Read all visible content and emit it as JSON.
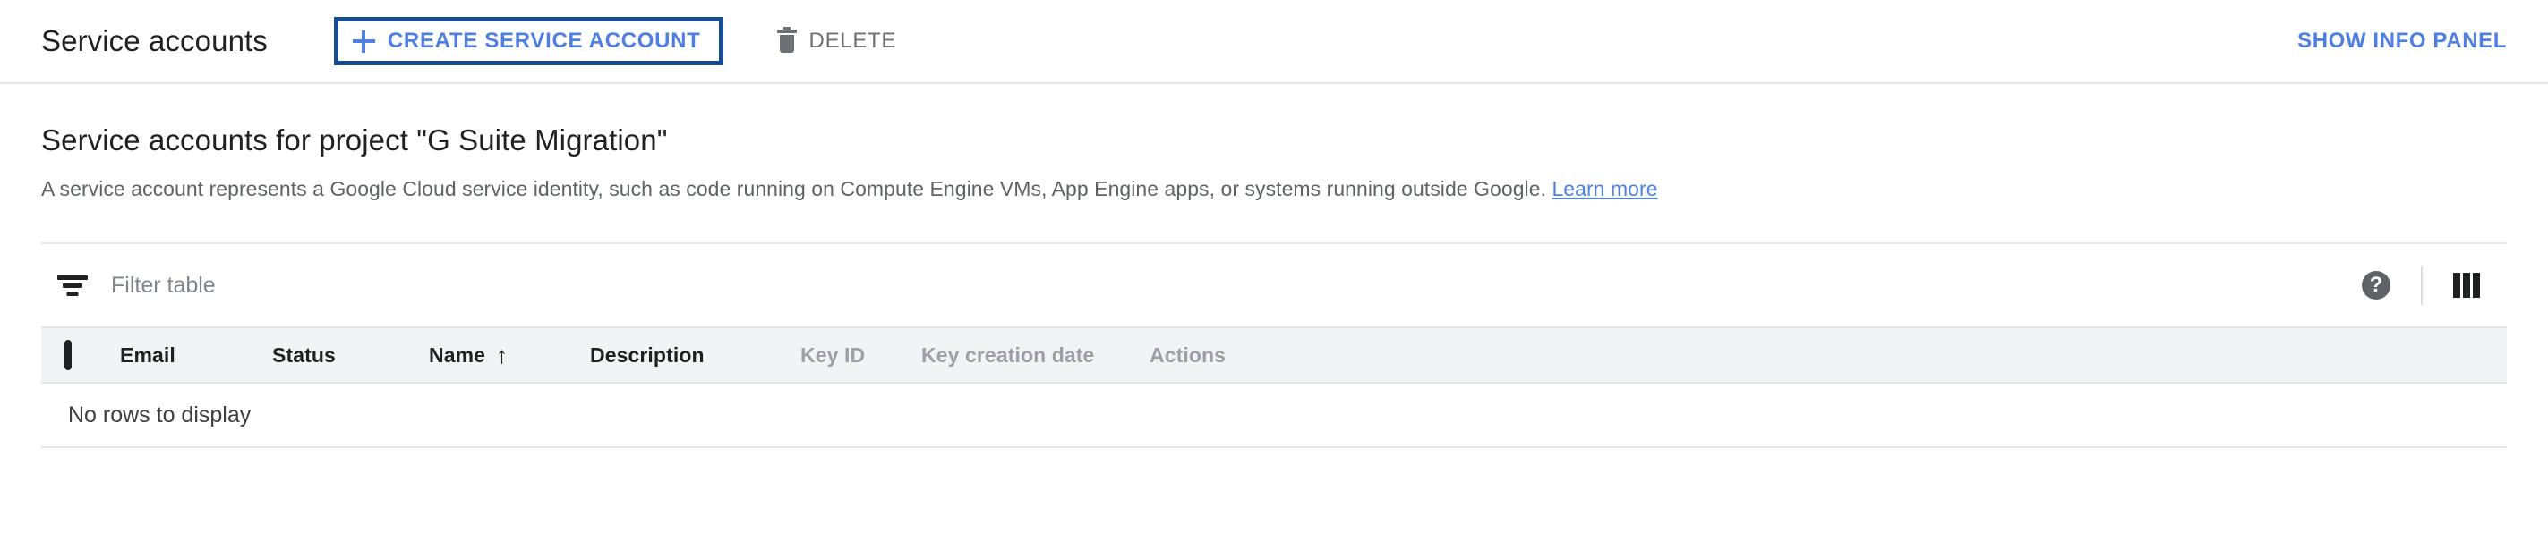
{
  "toolbar": {
    "title": "Service accounts",
    "create_button": {
      "label": "CREATE SERVICE ACCOUNT",
      "icon": "plus-icon",
      "focused": true,
      "text_color": "#4f7fe0",
      "focus_border_color": "#174b93"
    },
    "delete_button": {
      "label": "DELETE",
      "icon": "trash-icon",
      "disabled": true,
      "text_color": "#6d7175"
    },
    "info_panel_button": {
      "label": "SHOW INFO PANEL",
      "text_color": "#4f7fe0"
    }
  },
  "main": {
    "section_title": "Service accounts for project \"G Suite Migration\"",
    "description_text": "A service account represents a Google Cloud service identity, such as code running on Compute Engine VMs, App Engine apps, or systems running outside Google.",
    "description_link": "Learn more"
  },
  "filter_bar": {
    "icon": "filter-list-icon",
    "placeholder": "Filter table",
    "value": "",
    "help_icon": "help-icon",
    "help_glyph": "?",
    "columns_icon": "column-settings-icon"
  },
  "table": {
    "select_all_checkbox": {
      "checked": false
    },
    "columns": [
      {
        "label": "Email",
        "muted": false,
        "sorted": false
      },
      {
        "label": "Status",
        "muted": false,
        "sorted": false
      },
      {
        "label": "Name",
        "muted": false,
        "sorted": true,
        "sort_direction": "asc",
        "sort_glyph": "↑"
      },
      {
        "label": "Description",
        "muted": false,
        "sorted": false
      },
      {
        "label": "Key ID",
        "muted": true,
        "sorted": false
      },
      {
        "label": "Key creation date",
        "muted": true,
        "sorted": false
      },
      {
        "label": "Actions",
        "muted": true,
        "sorted": false
      }
    ],
    "rows": [],
    "empty_message": "No rows to display"
  },
  "colors": {
    "link_blue": "#4f7fe0",
    "focus_navy": "#174b93",
    "header_row_bg": "#f1f3f4",
    "border_gray": "#e4e6e8",
    "text_primary": "#202124",
    "text_secondary": "#5f6368",
    "text_muted": "#9aa0a6"
  }
}
